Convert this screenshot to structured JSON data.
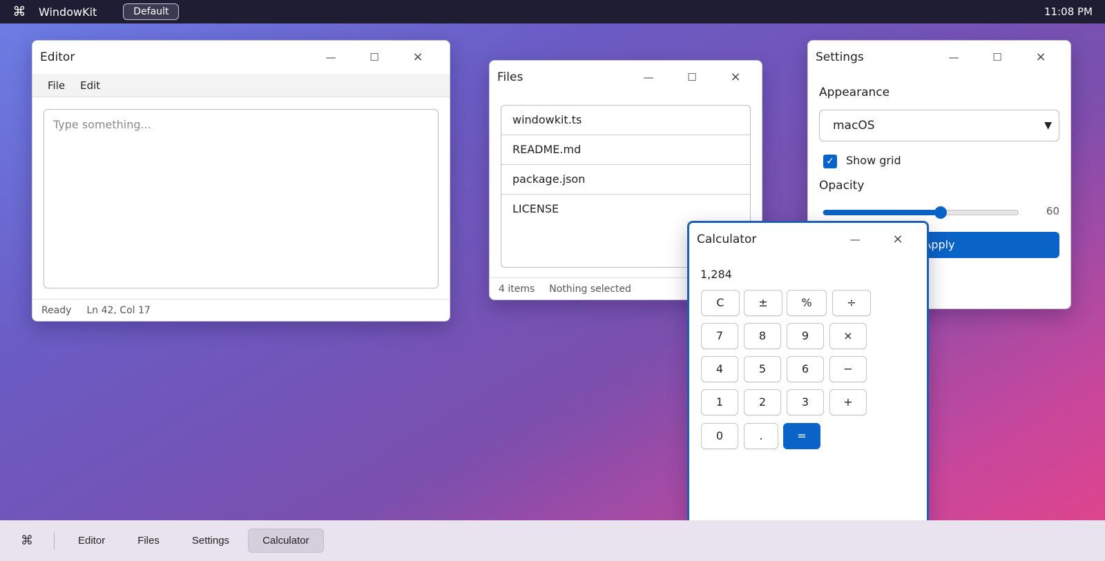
{
  "topbar": {
    "cmd_glyph": "⌘",
    "app_name": "WindowKit",
    "theme_label": "Default",
    "clock": "11:08 PM"
  },
  "window_controls": {
    "minimize": "—",
    "maximize": "☐",
    "close": "×"
  },
  "editor": {
    "title": "Editor",
    "menu": [
      "File",
      "Edit"
    ],
    "placeholder": "Type something...",
    "status": {
      "state": "Ready",
      "position": "Ln 42, Col 17"
    }
  },
  "files": {
    "title": "Files",
    "items": [
      "windowkit.ts",
      "README.md",
      "package.json",
      "LICENSE"
    ],
    "status": {
      "count": "4 items",
      "selection": "Nothing selected"
    }
  },
  "settings": {
    "title": "Settings",
    "appearance_label": "Appearance",
    "appearance_value": "macOS",
    "show_grid_label": "Show grid",
    "show_grid_checked": true,
    "opacity_label": "Opacity",
    "opacity_value": 60,
    "opacity_text": "60",
    "apply_label": "Apply"
  },
  "calculator": {
    "title": "Calculator",
    "display": "1,284",
    "keys": [
      [
        "C",
        "±",
        "%",
        "÷"
      ],
      [
        "7",
        "8",
        "9",
        "×"
      ],
      [
        "4",
        "5",
        "6",
        "−"
      ],
      [
        "1",
        "2",
        "3",
        "+"
      ],
      [
        "0",
        ".",
        "="
      ]
    ]
  },
  "taskbar": {
    "cmd_glyph": "⌘",
    "items": [
      "Editor",
      "Files",
      "Settings",
      "Calculator"
    ],
    "active": "Calculator"
  },
  "colors": {
    "accent": "#0a63c6",
    "topbar": "#1f1d33",
    "taskbar": "#e8e3ef"
  }
}
